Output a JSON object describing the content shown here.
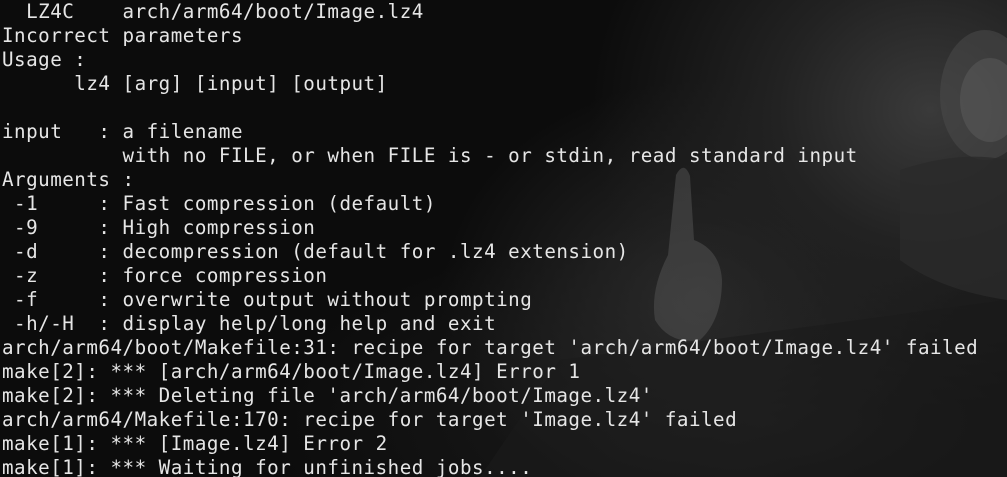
{
  "terminal": {
    "lines": [
      "  LZ4C    arch/arm64/boot/Image.lz4",
      "Incorrect parameters",
      "Usage :",
      "      lz4 [arg] [input] [output]",
      "",
      "input   : a filename",
      "          with no FILE, or when FILE is - or stdin, read standard input",
      "Arguments :",
      " -1     : Fast compression (default)",
      " -9     : High compression",
      " -d     : decompression (default for .lz4 extension)",
      " -z     : force compression",
      " -f     : overwrite output without prompting",
      " -h/-H  : display help/long help and exit",
      "arch/arm64/boot/Makefile:31: recipe for target 'arch/arm64/boot/Image.lz4' failed",
      "make[2]: *** [arch/arm64/boot/Image.lz4] Error 1",
      "make[2]: *** Deleting file 'arch/arm64/boot/Image.lz4'",
      "arch/arm64/Makefile:170: recipe for target 'Image.lz4' failed",
      "make[1]: *** [Image.lz4] Error 2",
      "make[1]: *** Waiting for unfinished jobs...."
    ]
  },
  "colors": {
    "background": "#0c0c0c",
    "text": "#e6e6e6"
  }
}
